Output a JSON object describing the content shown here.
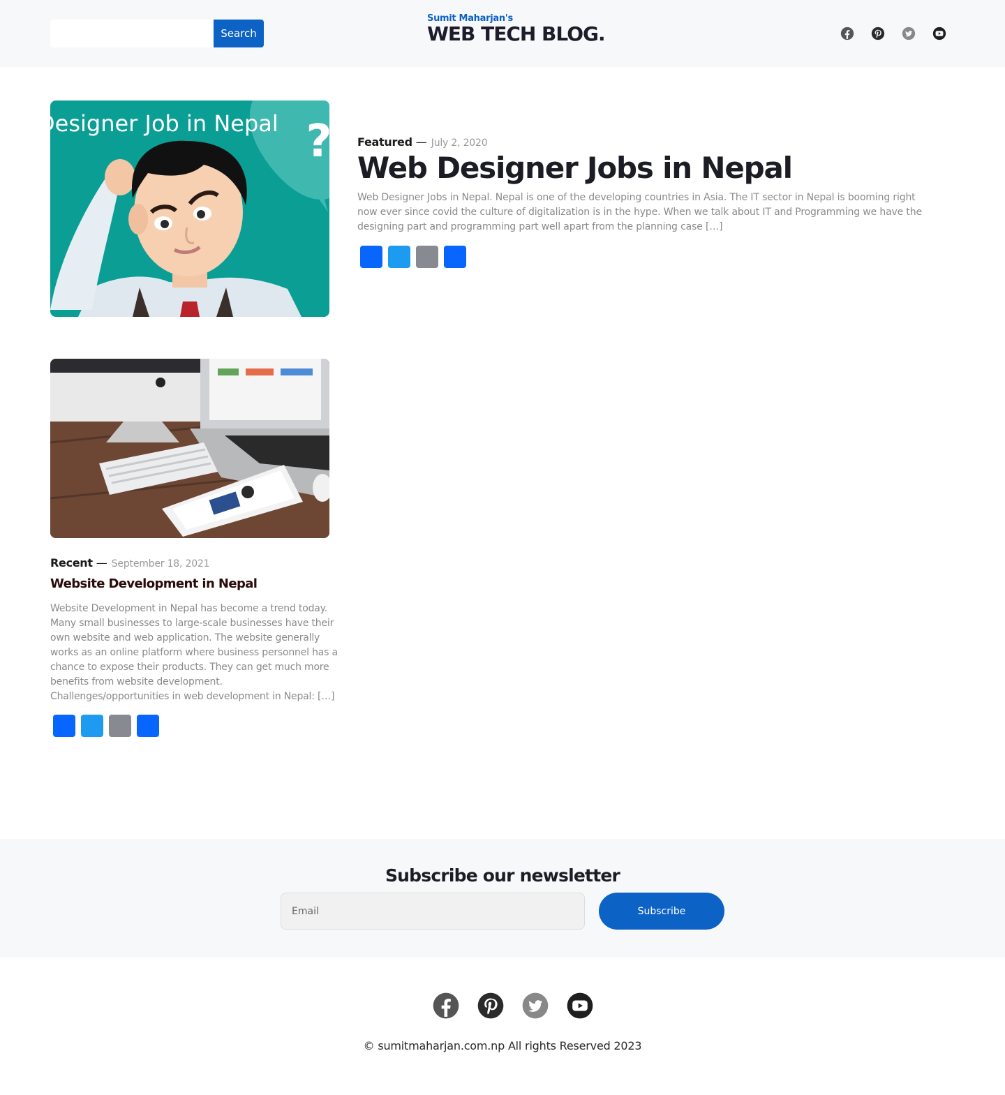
{
  "header": {
    "search": {
      "placeholder": "",
      "button_label": "Search"
    },
    "brand": {
      "subtitle": "Sumit Maharjan's",
      "title": "WEB TECH BLOG."
    },
    "social_icons": [
      "facebook-icon",
      "pinterest-icon",
      "twitter-icon",
      "youtube-icon"
    ]
  },
  "featured": {
    "image_caption": "Designer Job in Nepal",
    "category": "Featured",
    "dash": "—",
    "date": "July 2, 2020",
    "title": "Web Designer Jobs in Nepal",
    "excerpt": "Web Designer Jobs in Nepal.  Nepal is one of the developing countries in Asia.  The IT sector in Nepal is booming right now ever since covid the culture of digitalization is in the hype. When we talk about IT and Programming we have the designing part and programming part well apart from the planning case […]",
    "share_buttons": [
      "facebook",
      "twitter",
      "email",
      "share"
    ]
  },
  "recent": {
    "category": "Recent",
    "dash": "—",
    "date": "September 18, 2021",
    "title": "Website Development in Nepal",
    "excerpt": "Website Development in Nepal has become a trend today. Many small businesses to large-scale businesses have their own website and web application. The website generally works as an online platform where business personnel has a chance to expose their products. They can get much more benefits from website development. Challenges/opportunities in web development in Nepal: […]",
    "share_buttons": [
      "facebook",
      "twitter",
      "email",
      "share"
    ]
  },
  "newsletter": {
    "title": "Subscribe our newsletter",
    "email_placeholder": "Email",
    "button_label": "Subscribe"
  },
  "footer": {
    "social_icons": [
      "facebook-icon",
      "pinterest-icon",
      "twitter-icon",
      "youtube-icon"
    ],
    "copyright": "© sumitmaharjan.com.np All rights Reserved 2023"
  },
  "colors": {
    "brand_blue": "#0d63c5",
    "facebook": "#0866ff",
    "twitter": "#1d9bf0",
    "email": "#888a92",
    "header_bg": "#f7f8fa"
  }
}
